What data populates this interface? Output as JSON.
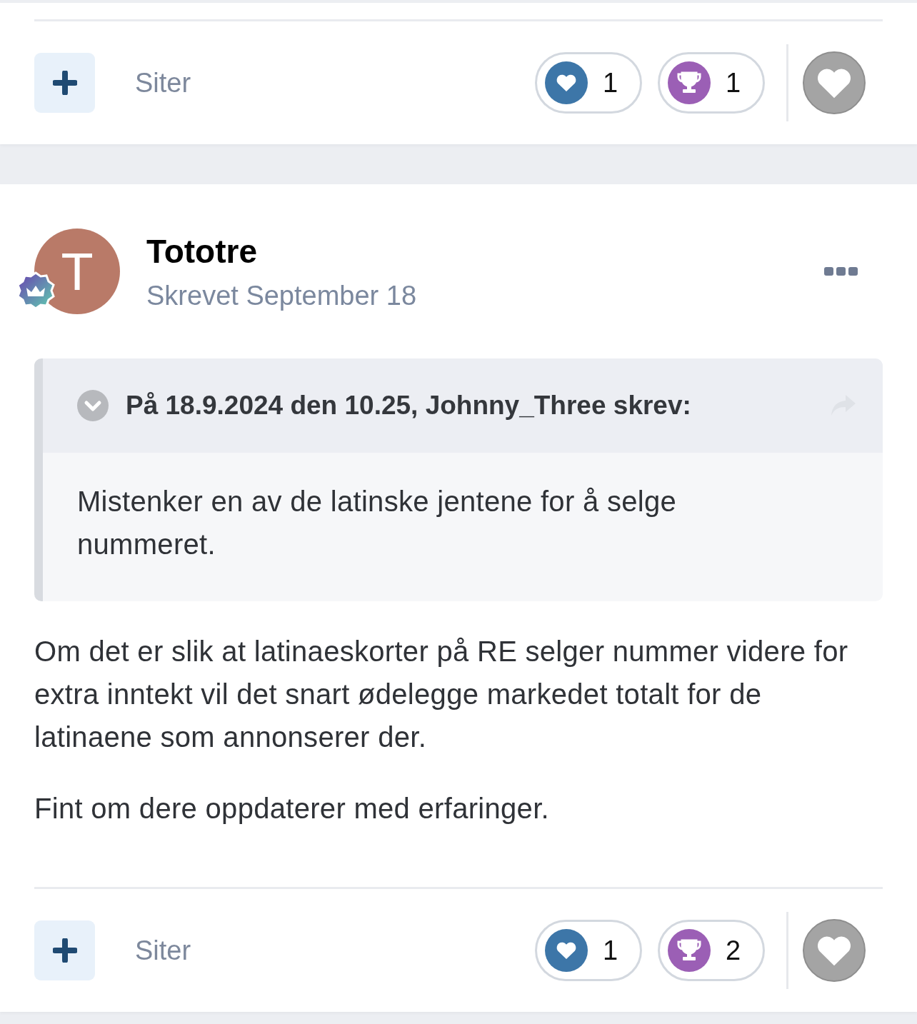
{
  "previous_post": {
    "actions": {
      "quote_label": "Siter",
      "reactions": [
        {
          "kind": "like",
          "count": "1"
        },
        {
          "kind": "trophy",
          "count": "1"
        }
      ],
      "reacted": false
    }
  },
  "post": {
    "author": {
      "initial": "T",
      "name": "Tototre"
    },
    "posted": "Skrevet September 18",
    "quote": {
      "citation": "På 18.9.2024 den 10.25, Johnny_Three skrev:",
      "text": "Mistenker en av de latinske jentene for å selge nummeret."
    },
    "paragraphs": [
      "Om det er slik at latinaeskorter på RE selger nummer videre for extra inntekt vil det snart ødelegge markedet totalt for de latinaene som annonserer der.",
      "Fint om dere oppdaterer med erfaringer."
    ],
    "actions": {
      "quote_label": "Siter",
      "reactions": [
        {
          "kind": "like",
          "count": "1"
        },
        {
          "kind": "trophy",
          "count": "2"
        }
      ],
      "reacted": false
    }
  }
}
